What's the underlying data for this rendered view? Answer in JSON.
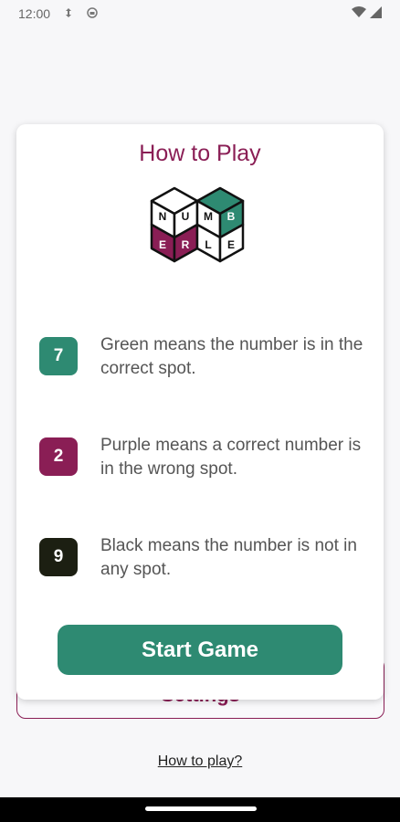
{
  "status_bar": {
    "time": "12:00",
    "icons": [
      "data-sync-icon",
      "face-status-icon",
      "wifi-icon",
      "signal-icon"
    ]
  },
  "background": {
    "settings_label": "Settings",
    "how_to_play_link": "How to play?"
  },
  "dialog": {
    "title": "How to Play",
    "logo_letters": [
      "N",
      "U",
      "M",
      "B",
      "E",
      "R",
      "L",
      "E"
    ],
    "rules": [
      {
        "number": "7",
        "color": "#2e8a72",
        "text": "Green means the number is in the correct spot."
      },
      {
        "number": "2",
        "color": "#8a1e55",
        "text": "Purple means a correct number is in the wrong spot."
      },
      {
        "number": "9",
        "color": "#1c1f12",
        "text": "Black means the number is not in any spot."
      }
    ],
    "start_button": "Start Game"
  },
  "colors": {
    "green": "#2e8a72",
    "purple": "#8a1e55",
    "black": "#1c1f12"
  }
}
